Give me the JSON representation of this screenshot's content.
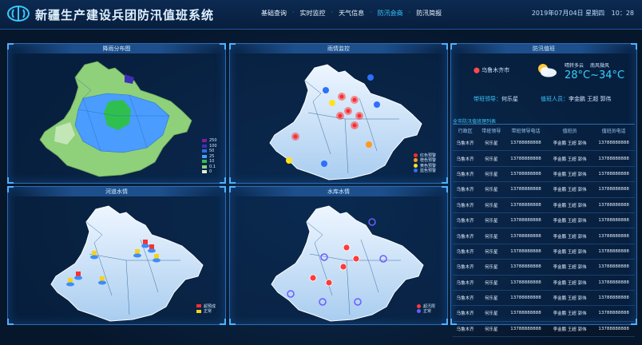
{
  "header": {
    "title": "新疆生产建设兵团防汛值班系统",
    "nav": [
      "基础查询",
      "实时监控",
      "天气信息",
      "防汛会商",
      "防汛简报"
    ],
    "active_index": 3,
    "date": "2019年07月04日 星期四",
    "time": "10：28"
  },
  "panels": {
    "rain": {
      "title": "降雨分布图"
    },
    "flood": {
      "title": "雨情监控"
    },
    "river": {
      "title": "河道水情"
    },
    "reservoir": {
      "title": "水库水情"
    }
  },
  "rain_legend": [
    {
      "label": "250",
      "color": "#7b1fa2"
    },
    {
      "label": "100",
      "color": "#3f2fb5"
    },
    {
      "label": "50",
      "color": "#2e6fe0"
    },
    {
      "label": "25",
      "color": "#4a9cff"
    },
    {
      "label": "10",
      "color": "#2fbf4f"
    },
    {
      "label": "0.1",
      "color": "#8fd07a"
    },
    {
      "label": "0",
      "color": "#d9efd2"
    }
  ],
  "alarm_legend": [
    {
      "label": "红色预警",
      "color": "#ff2b2b"
    },
    {
      "label": "橙色预警",
      "color": "#ff9a1f"
    },
    {
      "label": "黄色预警",
      "color": "#ffe21f"
    },
    {
      "label": "蓝色预警",
      "color": "#2f6fff"
    }
  ],
  "river_legend": [
    {
      "label": "超预成",
      "color": "#ff3030"
    },
    {
      "label": "正常",
      "color": "#f5d21f"
    }
  ],
  "reservoir_legend": [
    {
      "label": "超汛限",
      "color": "#ff3a3a"
    },
    {
      "label": "正常",
      "color": "#6a5cff"
    }
  ],
  "duty": {
    "title": "防汛值班",
    "city": "乌鲁木齐市",
    "weather": "晴转多云",
    "wind": "南风微风",
    "temp": "28°C~34°C",
    "leader_label": "带班领导：",
    "leader": "何乐星",
    "staff_label": "值班人员：",
    "staff": "李金鹏 王超 郭伟"
  },
  "table": {
    "title": "全市防汛值班理列表",
    "headers": [
      "行政区",
      "带班领导",
      "带班领导电话",
      "值班员",
      "值班员电话"
    ],
    "rows": [
      [
        "乌鲁木齐",
        "何乐星",
        "13788888888",
        "李金鹏 王超 郭伟",
        "13788888888"
      ],
      [
        "乌鲁木齐",
        "何乐星",
        "13788888888",
        "李金鹏 王超 郭伟",
        "13788888888"
      ],
      [
        "乌鲁木齐",
        "何乐星",
        "13788888888",
        "李金鹏 王超 郭伟",
        "13788888888"
      ],
      [
        "乌鲁木齐",
        "何乐星",
        "13788888888",
        "李金鹏 王超 郭伟",
        "13788888888"
      ],
      [
        "乌鲁木齐",
        "何乐星",
        "13788888888",
        "李金鹏 王超 郭伟",
        "13788888888"
      ],
      [
        "乌鲁木齐",
        "何乐星",
        "13788888888",
        "李金鹏 王超 郭伟",
        "13788888888"
      ],
      [
        "乌鲁木齐",
        "何乐星",
        "13788888888",
        "李金鹏 王超 郭伟",
        "13788888888"
      ],
      [
        "乌鲁木齐",
        "何乐星",
        "13788888888",
        "李金鹏 王超 郭伟",
        "13788888888"
      ],
      [
        "乌鲁木齐",
        "何乐星",
        "13788888888",
        "李金鹏 王超 郭伟",
        "13788888888"
      ],
      [
        "乌鲁木齐",
        "何乐星",
        "13788888888",
        "李金鹏 王超 郭伟",
        "13788888888"
      ],
      [
        "乌鲁木齐",
        "何乐星",
        "13788888888",
        "李金鹏 王超 郭伟",
        "13788888888"
      ],
      [
        "乌鲁木齐",
        "何乐星",
        "13788888888",
        "李金鹏 王超 郭伟",
        "13788888888"
      ],
      [
        "乌鲁木齐",
        "何乐星",
        "13788888888",
        "李金鹏 王超 郭伟",
        "13788888888"
      ]
    ]
  }
}
